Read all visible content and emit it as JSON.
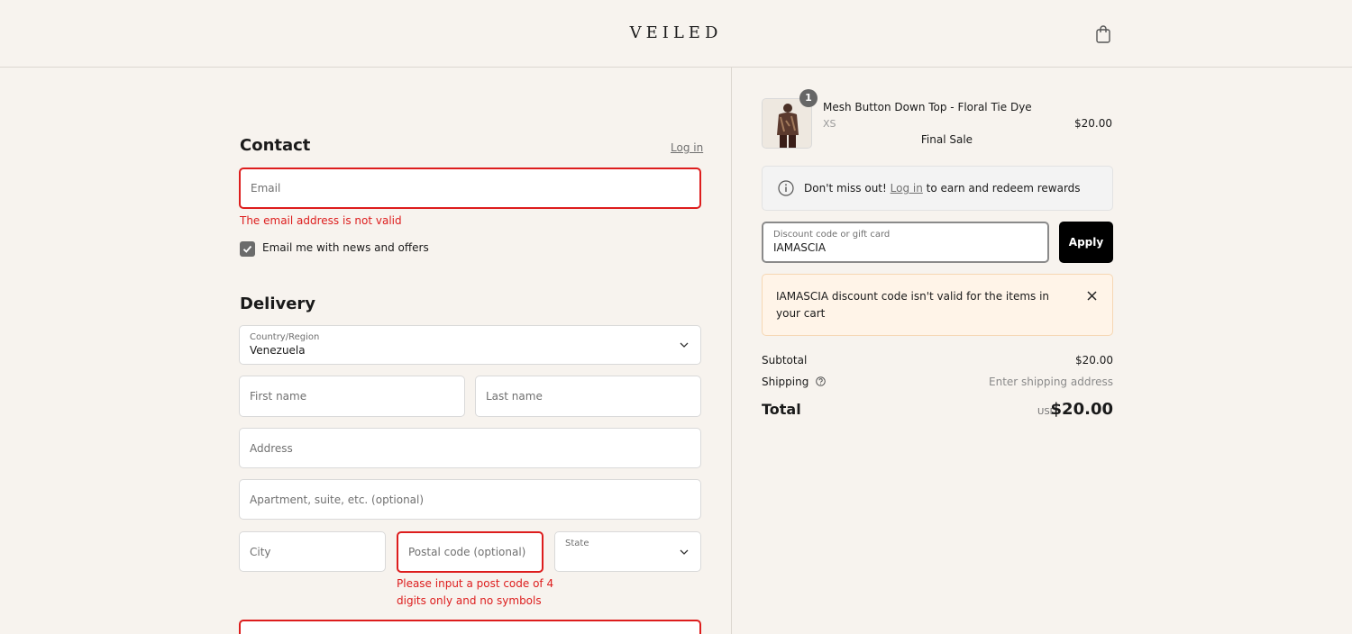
{
  "header": {
    "logo": "VEILED",
    "cart_icon": "shopping-bag-icon"
  },
  "contact": {
    "title": "Contact",
    "login_link": "Log in",
    "email": {
      "placeholder": "Email",
      "value": "",
      "error": "The email address is not valid"
    },
    "newsletter": {
      "label": "Email me with news and offers",
      "checked": true
    }
  },
  "delivery": {
    "title": "Delivery",
    "country": {
      "label": "Country/Region",
      "value": "Venezuela"
    },
    "first_name": {
      "placeholder": "First name"
    },
    "last_name": {
      "placeholder": "Last name"
    },
    "address": {
      "placeholder": "Address"
    },
    "apartment": {
      "placeholder": "Apartment, suite, etc. (optional)"
    },
    "city": {
      "placeholder": "City"
    },
    "postal": {
      "placeholder": "Postal code (optional)",
      "error_line1": "Please input a post code of 4",
      "error_line2": "digits only and no symbols"
    },
    "state": {
      "label": "State"
    }
  },
  "summary": {
    "product": {
      "name": "Mesh Button Down Top - Floral Tie Dye",
      "variant": "XS",
      "note": "Final Sale",
      "price": "$20.00",
      "quantity": "1"
    },
    "rewards": {
      "before": "Don't miss out!",
      "link": "Log in",
      "after": "to earn and redeem rewards"
    },
    "discount": {
      "label": "Discount code or gift card",
      "value": "IAMASCIA",
      "apply_label": "Apply"
    },
    "notice": {
      "code": "IAMASCIA",
      "message": "discount code isn't valid for the items in your cart"
    },
    "subtotal": {
      "label": "Subtotal",
      "value": "$20.00"
    },
    "shipping": {
      "label": "Shipping",
      "value": "Enter shipping address"
    },
    "total": {
      "label": "Total",
      "currency": "USD",
      "value": "$20.00"
    }
  },
  "colors": {
    "error": "#dd1d1d",
    "background": "#f7f3ee",
    "accent": "#000000"
  }
}
